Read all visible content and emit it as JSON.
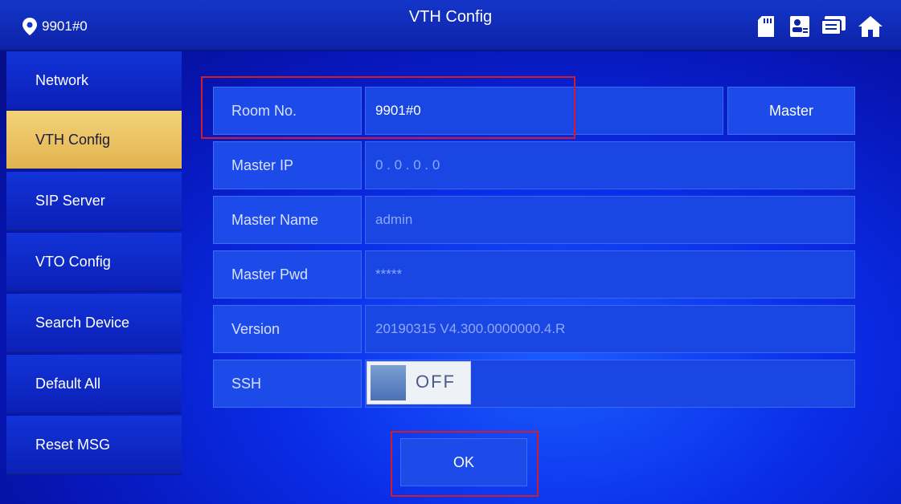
{
  "header": {
    "room": "9901#0",
    "title": "VTH Config",
    "icons": [
      "sd-card-icon",
      "contact-card-icon",
      "message-icon",
      "home-icon"
    ]
  },
  "sidebar": {
    "items": [
      {
        "label": "Network",
        "active": false
      },
      {
        "label": "VTH Config",
        "active": true
      },
      {
        "label": "SIP Server",
        "active": false
      },
      {
        "label": "VTO Config",
        "active": false
      },
      {
        "label": "Search Device",
        "active": false
      },
      {
        "label": "Default All",
        "active": false
      },
      {
        "label": "Reset MSG",
        "active": false
      }
    ]
  },
  "form": {
    "room_no": {
      "label": "Room No.",
      "value": "9901#0"
    },
    "master_button": "Master",
    "master_ip": {
      "label": "Master IP",
      "value": "0 . 0 . 0 . 0"
    },
    "master_name": {
      "label": "Master Name",
      "value": "admin"
    },
    "master_pwd": {
      "label": "Master Pwd",
      "value": "*****"
    },
    "version": {
      "label": "Version",
      "value": "20190315 V4.300.0000000.4.R"
    },
    "ssh": {
      "label": "SSH",
      "state": "OFF"
    }
  },
  "ok_button": "OK",
  "colors": {
    "highlight": "#d11d2b",
    "active_tab": "#e9c060",
    "background": "#0a2de8"
  }
}
